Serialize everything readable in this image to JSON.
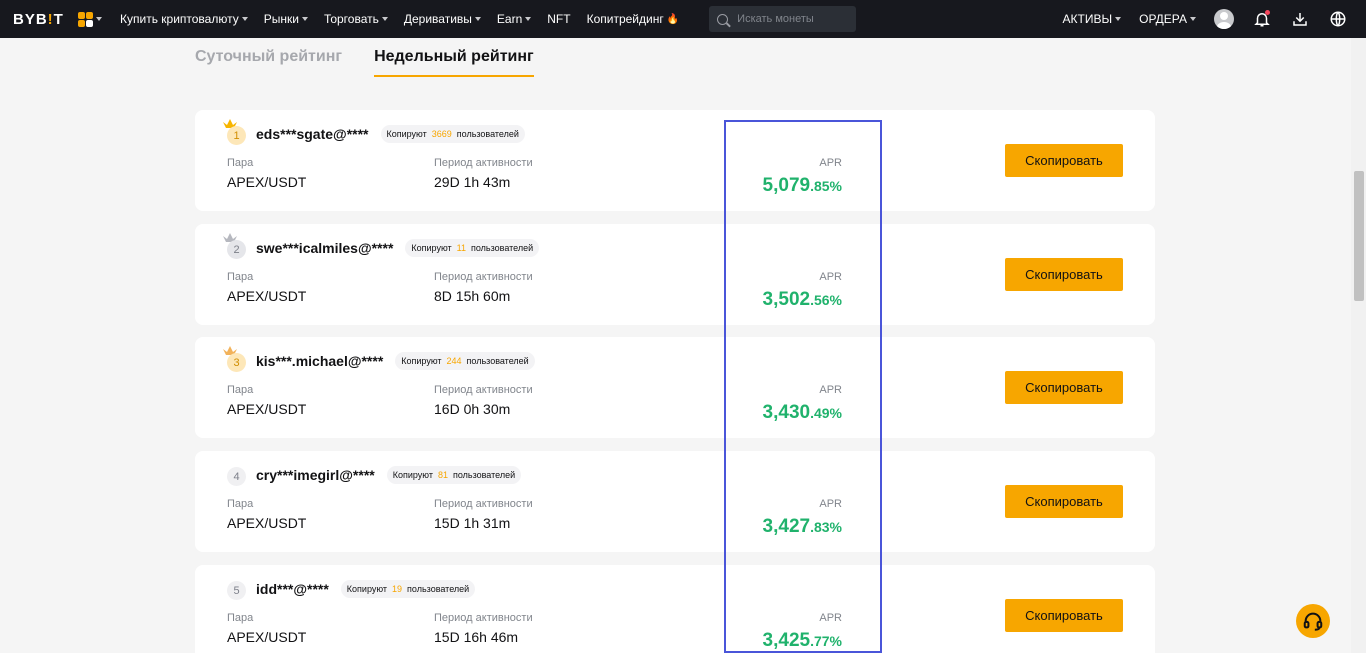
{
  "header": {
    "logo": {
      "left": "BYB",
      "accent": "!",
      "right": "T"
    },
    "nav": [
      {
        "label": "Купить криптовалюту",
        "caret": true
      },
      {
        "label": "Рынки",
        "caret": true
      },
      {
        "label": "Торговать",
        "caret": true
      },
      {
        "label": "Деривативы",
        "caret": true
      },
      {
        "label": "Earn",
        "caret": true
      },
      {
        "label": "NFT",
        "caret": false
      },
      {
        "label": "Копитрейдинг",
        "caret": false
      }
    ],
    "search_placeholder": "Искать монеты",
    "assets_label": "АКТИВЫ",
    "orders_label": "ОРДЕРА"
  },
  "tabs": {
    "daily": "Суточный рейтинг",
    "weekly": "Недельный рейтинг"
  },
  "labels": {
    "pair": "Пара",
    "period": "Период активности",
    "apr": "APR",
    "copying": "Копируют",
    "users": "пользователей",
    "copy_button": "Скопировать"
  },
  "traders": [
    {
      "rank": "1",
      "name": "eds***sgate@****",
      "copiers": "3669",
      "pair": "APEX/USDT",
      "period": "29D 1h 43m",
      "apr_int": "5,079",
      "apr_dec": ".85%"
    },
    {
      "rank": "2",
      "name": "swe***icalmiles@****",
      "copiers": "11",
      "pair": "APEX/USDT",
      "period": "8D 15h 60m",
      "apr_int": "3,502",
      "apr_dec": ".56%"
    },
    {
      "rank": "3",
      "name": "kis***.michael@****",
      "copiers": "244",
      "pair": "APEX/USDT",
      "period": "16D 0h 30m",
      "apr_int": "3,430",
      "apr_dec": ".49%"
    },
    {
      "rank": "4",
      "name": "cry***imegirl@****",
      "copiers": "81",
      "pair": "APEX/USDT",
      "period": "15D 1h 31m",
      "apr_int": "3,427",
      "apr_dec": ".83%"
    },
    {
      "rank": "5",
      "name": "idd***@****",
      "copiers": "19",
      "pair": "APEX/USDT",
      "period": "15D 16h 46m",
      "apr_int": "3,425",
      "apr_dec": ".77%"
    }
  ],
  "colors": {
    "accent": "#f7a600",
    "apr_green": "#20b26c",
    "header_bg": "#17181e",
    "highlight": "#4a55d9"
  }
}
